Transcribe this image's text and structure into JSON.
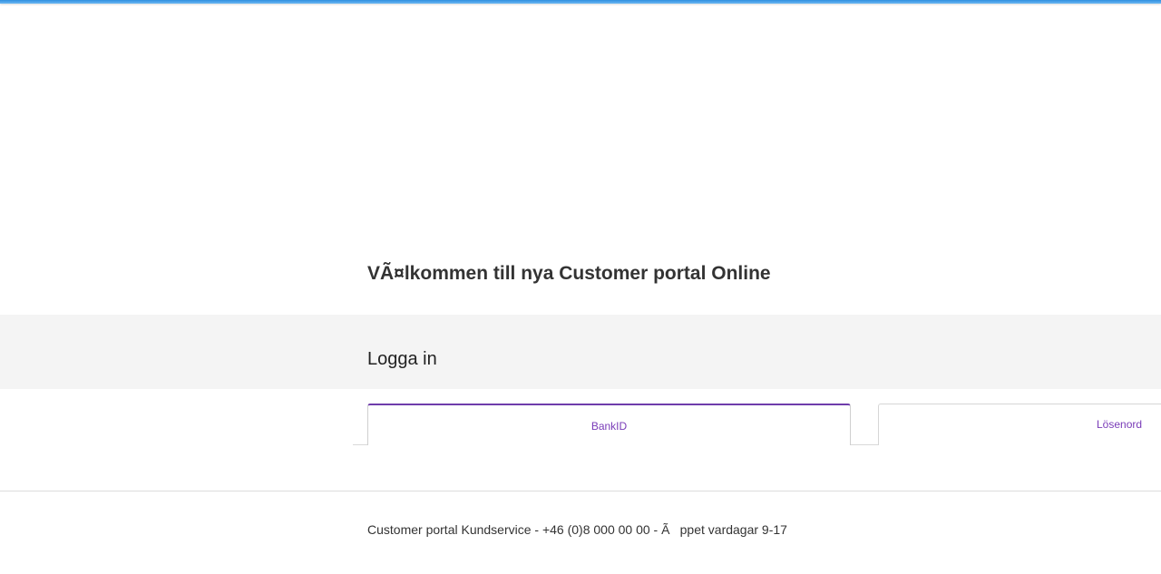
{
  "header": {
    "welcome_title": "VÃ¤lkommen till nya Customer portal Online"
  },
  "login": {
    "heading": "Logga in",
    "tabs": [
      {
        "label": "BankID",
        "active": true
      },
      {
        "label": "Lösenord",
        "active": false
      }
    ]
  },
  "footer": {
    "text": "Customer portal Kundservice - +46 (0)8 000 00 00 - Ãppet vardagar 9-17"
  },
  "colors": {
    "accent": "#6f3cab",
    "tab_text": "#7a3cb8",
    "top_bar": "#2f8fe0",
    "band_background": "#f4f4f4"
  }
}
